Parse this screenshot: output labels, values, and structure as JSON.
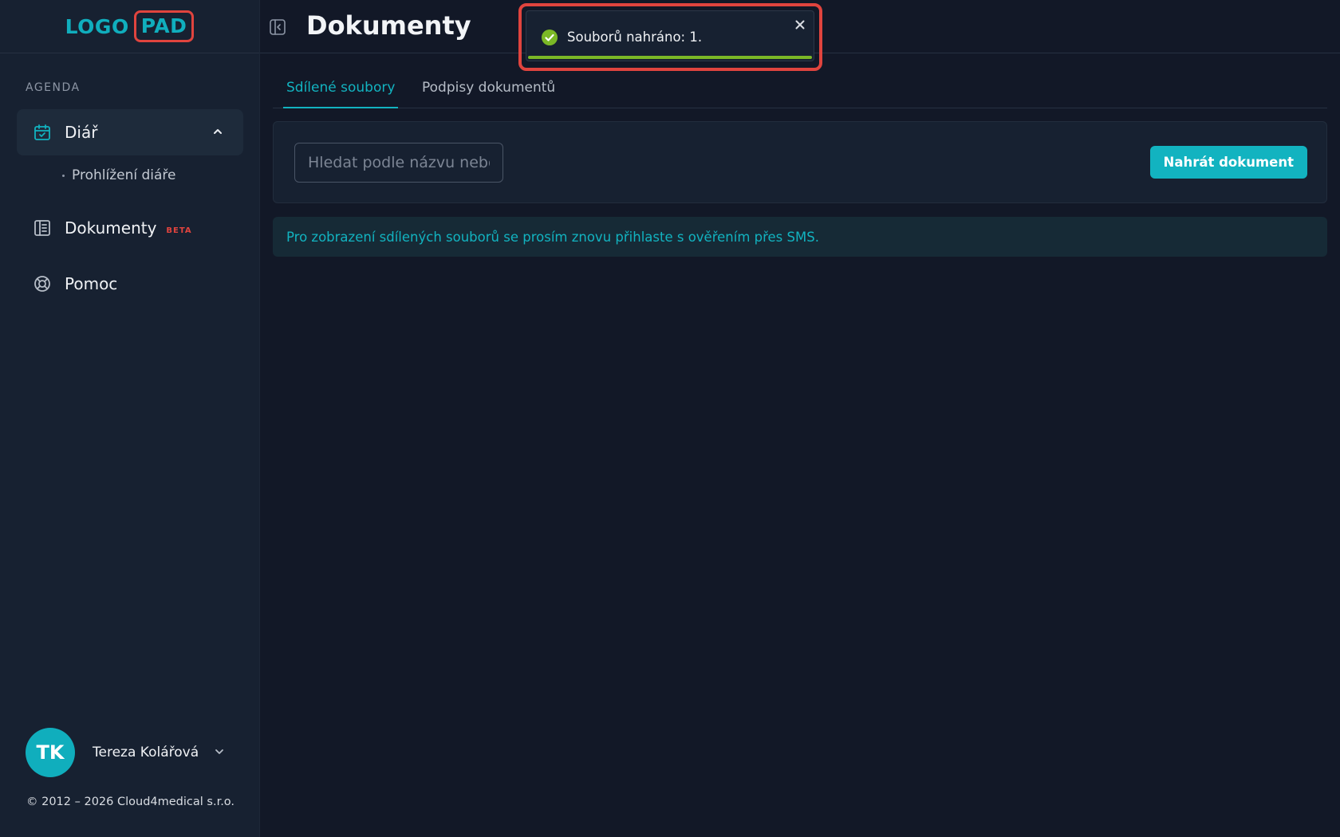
{
  "sidebar": {
    "logo": {
      "word": "LOGO",
      "box": "PAD"
    },
    "section_label": "AGENDA",
    "items": [
      {
        "label": "Diář",
        "icon": "calendar-check-icon",
        "expanded": true
      },
      {
        "label": "Dokumenty",
        "icon": "document-icon",
        "badge": "BETA"
      },
      {
        "label": "Pomoc",
        "icon": "lifebuoy-icon"
      }
    ],
    "sub_items": [
      {
        "label": "Prohlížení diáře"
      }
    ],
    "user": {
      "initials": "TK",
      "name": "Tereza Kolářová"
    },
    "copyright": "© 2012 – 2026 Cloud4medical s.r.o."
  },
  "header": {
    "title": "Dokumenty"
  },
  "tabs": [
    {
      "label": "Sdílené soubory",
      "active": true
    },
    {
      "label": "Podpisy dokumentů",
      "active": false
    }
  ],
  "search": {
    "placeholder": "Hledat podle názvu nebo",
    "value": ""
  },
  "toolbar": {
    "upload_label": "Nahrát dokument"
  },
  "info_banner": {
    "text": "Pro zobrazení sdílených souborů se prosím znovu přihlaste s ověřením přes SMS."
  },
  "toast": {
    "message": "Souborů nahráno: 1.",
    "status": "success",
    "progress": 1.0
  },
  "colors": {
    "accent": "#12b3c0",
    "highlight": "#e0443e",
    "success": "#7bb826",
    "background": "#121827",
    "sidebar": "#172131"
  }
}
